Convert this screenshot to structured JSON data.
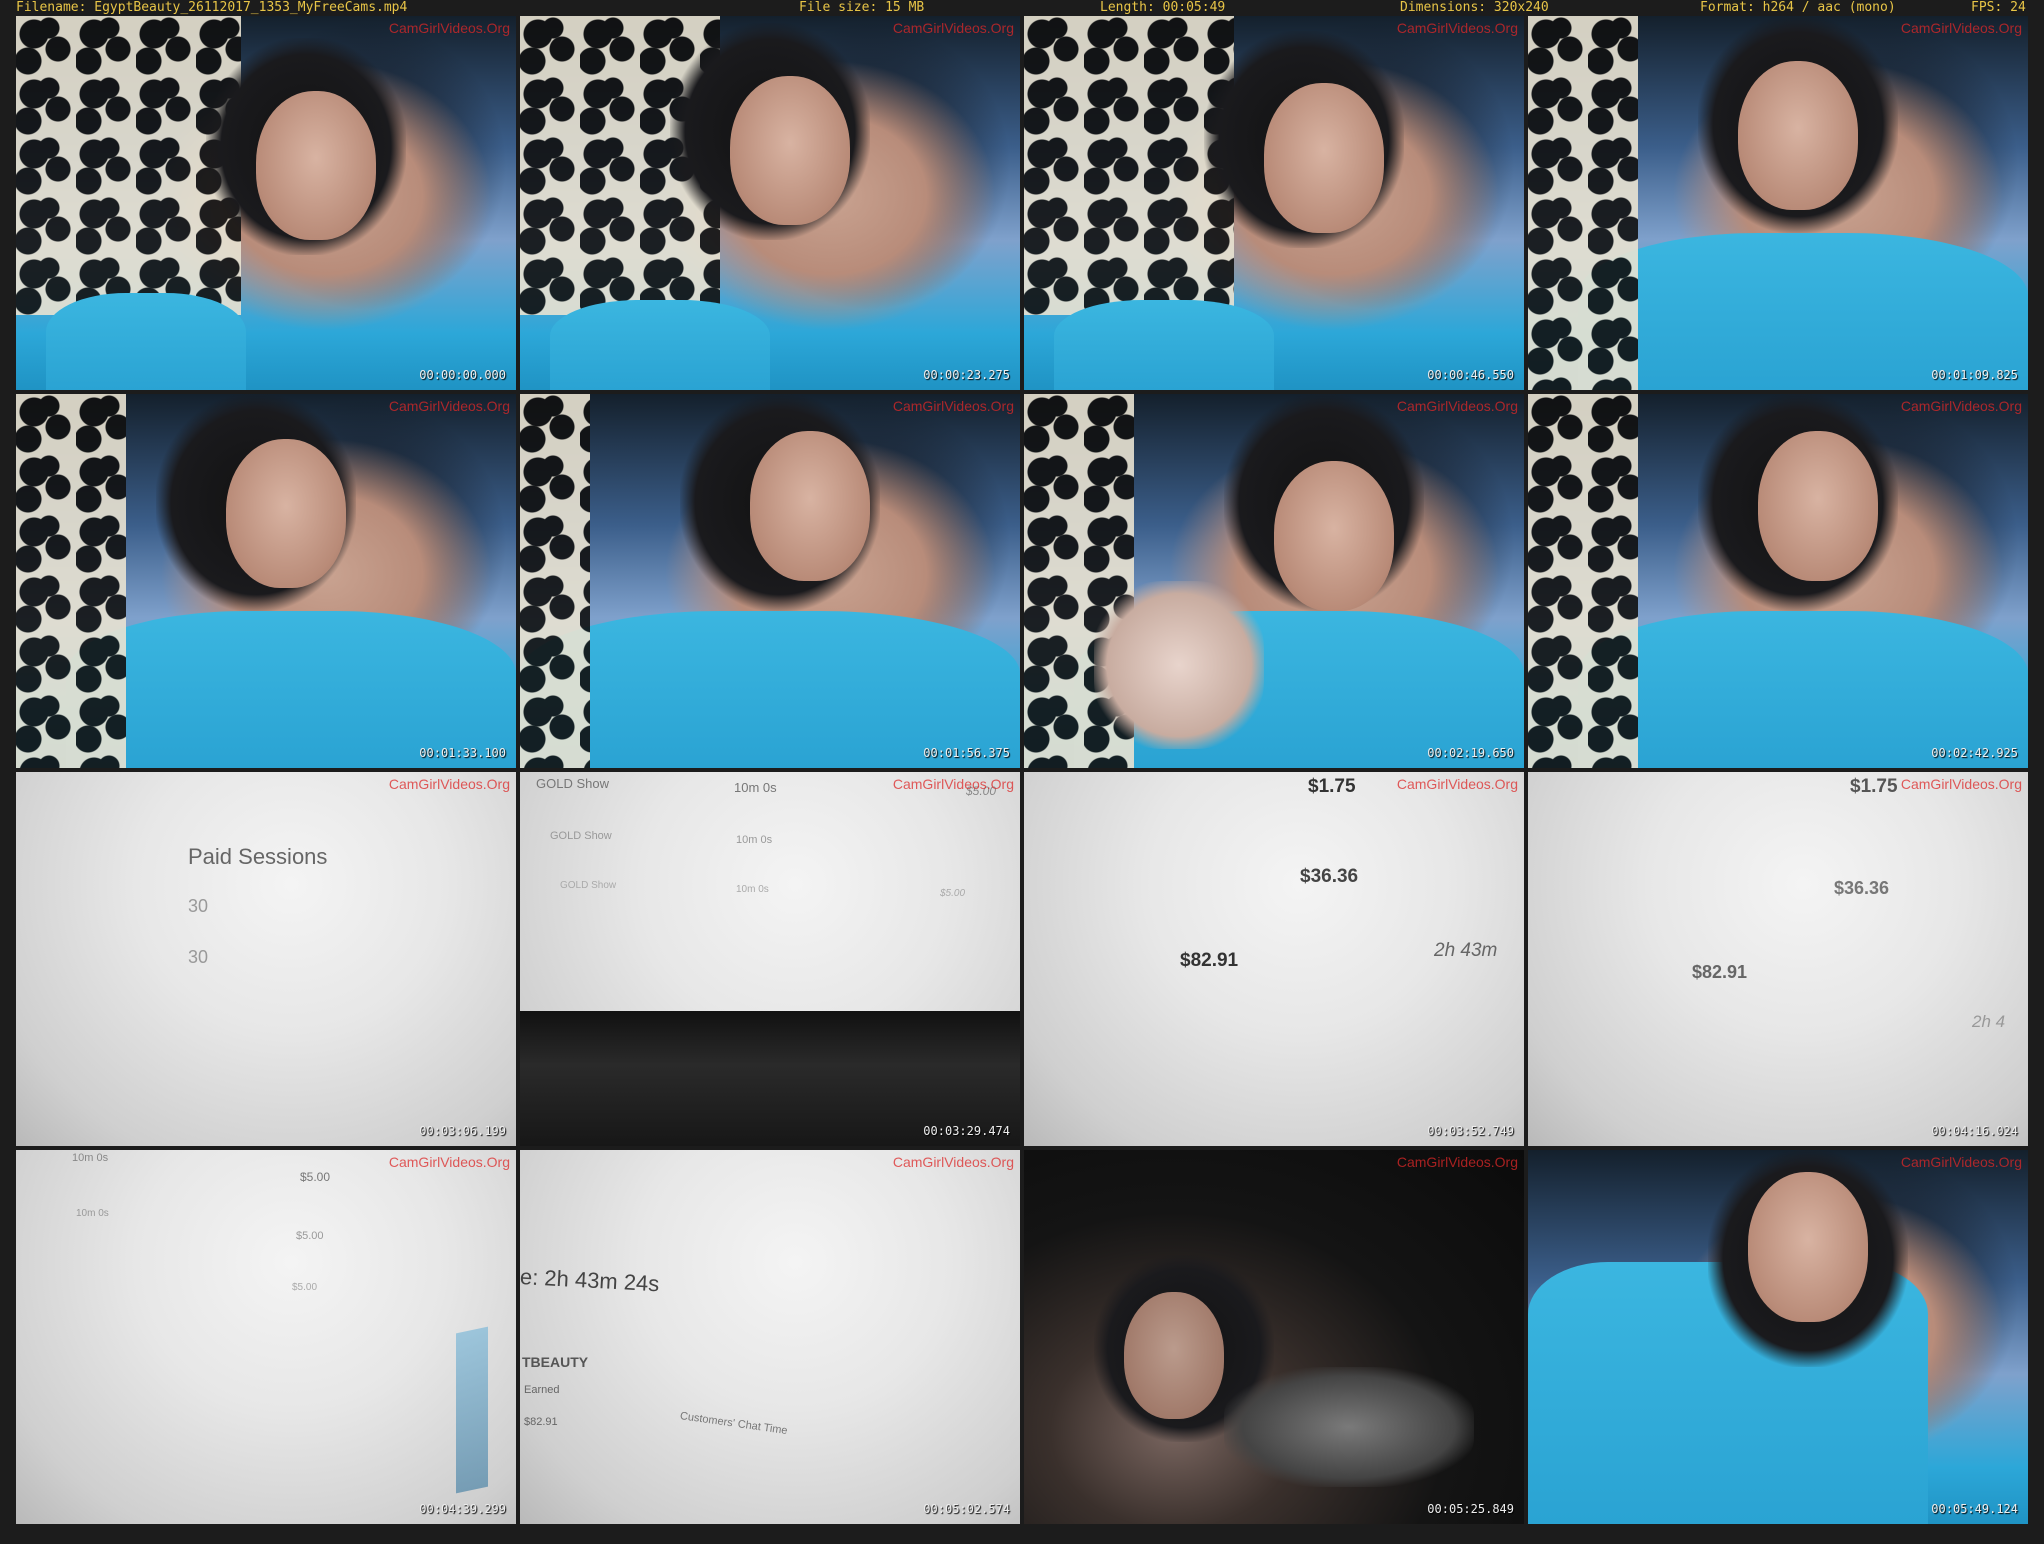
{
  "header": {
    "filename": "Filename: EgyptBeauty_26112017_1353_MyFreeCams.mp4",
    "filesize": "File size: 15 MB",
    "length": "Length: 00:05:49",
    "dimensions": "Dimensions: 320x240",
    "format": "Format: h264 / aac (mono)",
    "fps": "FPS: 24"
  },
  "watermark": "CamGirlVideos.Org",
  "thumbnails": [
    {
      "timestamp": "00:00:00.000",
      "scene": "cam"
    },
    {
      "timestamp": "00:00:23.275",
      "scene": "cam"
    },
    {
      "timestamp": "00:00:46.550",
      "scene": "cam"
    },
    {
      "timestamp": "00:01:09.825",
      "scene": "cam"
    },
    {
      "timestamp": "00:01:33.100",
      "scene": "cam"
    },
    {
      "timestamp": "00:01:56.375",
      "scene": "cam"
    },
    {
      "timestamp": "00:02:19.650",
      "scene": "cam"
    },
    {
      "timestamp": "00:02:42.925",
      "scene": "cam"
    },
    {
      "timestamp": "00:03:06.199",
      "scene": "screen",
      "texts": [
        "Paid Sessions",
        "30",
        "30"
      ]
    },
    {
      "timestamp": "00:03:29.474",
      "scene": "screen",
      "texts": [
        "GOLD Show",
        "10m 0s",
        "$5.00",
        "GOLD Show",
        "10m 0s",
        "GOLD Show",
        "10m 0s",
        "$5.00"
      ]
    },
    {
      "timestamp": "00:03:52.749",
      "scene": "screen",
      "texts": [
        "$1.75",
        "$36.36",
        "$82.91",
        "2h 43m"
      ]
    },
    {
      "timestamp": "00:04:16.024",
      "scene": "screen",
      "texts": [
        "$1.75",
        "$36.36",
        "$82.91",
        "2h 4"
      ]
    },
    {
      "timestamp": "00:04:39.299",
      "scene": "screen",
      "texts": [
        "10m 0s",
        "$5.00",
        "10m 0s",
        "$5.00",
        "$5.00"
      ]
    },
    {
      "timestamp": "00:05:02.574",
      "scene": "screen",
      "texts": [
        "e: 2h 43m 24s",
        "TBEAUTY",
        "Earned",
        "$82.91",
        "Customers' Chat Time"
      ]
    },
    {
      "timestamp": "00:05:25.849",
      "scene": "dark"
    },
    {
      "timestamp": "00:05:49.124",
      "scene": "cam"
    }
  ]
}
